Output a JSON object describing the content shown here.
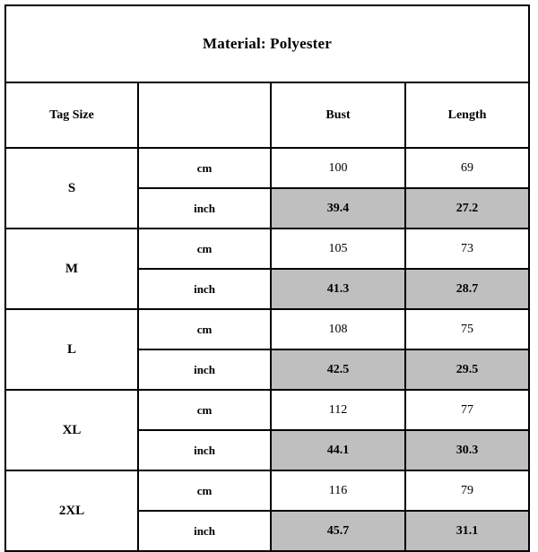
{
  "document": {
    "title": "Material: Polyester",
    "colors": {
      "border": "#000000",
      "page_background": "#ffffff",
      "inch_row_highlight": "#bfbfbf",
      "text": "#000000"
    }
  },
  "table": {
    "headers": {
      "size": "Tag Size",
      "unit": "",
      "bust": "Bust",
      "length": "Length"
    },
    "unit_labels": {
      "cm": "cm",
      "inch": "inch"
    },
    "rows": [
      {
        "size": "S",
        "cm": {
          "bust": "100",
          "length": "69"
        },
        "inch": {
          "bust": "39.4",
          "length": "27.2"
        }
      },
      {
        "size": "M",
        "cm": {
          "bust": "105",
          "length": "73"
        },
        "inch": {
          "bust": "41.3",
          "length": "28.7"
        }
      },
      {
        "size": "L",
        "cm": {
          "bust": "108",
          "length": "75"
        },
        "inch": {
          "bust": "42.5",
          "length": "29.5"
        }
      },
      {
        "size": "XL",
        "cm": {
          "bust": "112",
          "length": "77"
        },
        "inch": {
          "bust": "44.1",
          "length": "30.3"
        }
      },
      {
        "size": "2XL",
        "cm": {
          "bust": "116",
          "length": "79"
        },
        "inch": {
          "bust": "45.7",
          "length": "31.1"
        }
      }
    ]
  }
}
